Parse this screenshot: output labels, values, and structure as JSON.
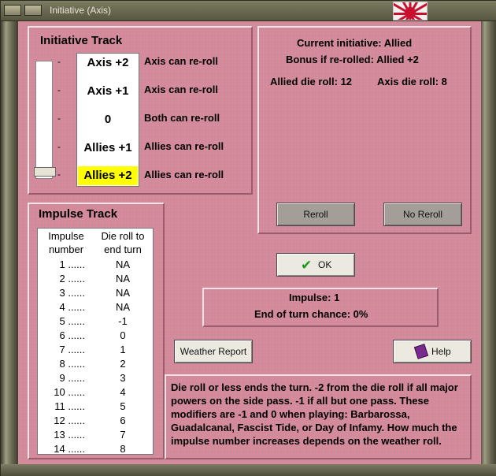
{
  "window": {
    "title": "Initiative (Axis)"
  },
  "initiative_track": {
    "title": "Initiative Track",
    "levels": [
      {
        "label": "Axis +2",
        "desc": "Axis can re-roll",
        "highlight": false
      },
      {
        "label": "Axis +1",
        "desc": "Axis can re-roll",
        "highlight": false
      },
      {
        "label": "0",
        "desc": "Both can re-roll",
        "highlight": false
      },
      {
        "label": "Allies +1",
        "desc": "Allies can re-roll",
        "highlight": false
      },
      {
        "label": "Allies +2",
        "desc": "Allies can re-roll",
        "highlight": true
      }
    ],
    "tick": "-",
    "selected_level": "Allies +2"
  },
  "status": {
    "current_initiative": "Current initiative: Allied",
    "bonus": "Bonus if re-rolled: Allied +2",
    "allied_roll": "Allied die roll: 12",
    "axis_roll": "Axis die roll: 8"
  },
  "buttons": {
    "reroll": "Reroll",
    "no_reroll": "No Reroll",
    "ok": "OK",
    "weather_report": "Weather Report",
    "help": "Help"
  },
  "impulse_info": {
    "impulse": "Impulse: 1",
    "end_chance": "End of turn chance: 0%"
  },
  "impulse_track": {
    "title": "Impulse Track",
    "col1_header": [
      "Impulse",
      "number"
    ],
    "col2_header": [
      "Die roll to",
      "end turn"
    ],
    "rows": [
      {
        "num": "1 ......",
        "val": "NA"
      },
      {
        "num": "2 ......",
        "val": "NA"
      },
      {
        "num": "3 ......",
        "val": "NA"
      },
      {
        "num": "4 ......",
        "val": "NA"
      },
      {
        "num": "5 ......",
        "val": "-1"
      },
      {
        "num": "6 ......",
        "val": "0"
      },
      {
        "num": "7 ......",
        "val": "1"
      },
      {
        "num": "8 ......",
        "val": "2"
      },
      {
        "num": "9 ......",
        "val": "3"
      },
      {
        "num": "10 ......",
        "val": "4"
      },
      {
        "num": "11 ......",
        "val": "5"
      },
      {
        "num": "12 ......",
        "val": "6"
      },
      {
        "num": "13 ......",
        "val": "7"
      },
      {
        "num": "14 ......",
        "val": "8"
      }
    ]
  },
  "note": "Die roll or less ends the turn.  -2 from the die roll if all major powers on the side pass.  -1 if all but one pass.  These modifiers are -1 and 0 when playing: Barbarossa, Guadalcanal, Fascist Tide, or Day of Infamy.  How much the impulse number increases depends on the weather roll.",
  "colors": {
    "background": "#d48c9c",
    "highlight": "#ffff00",
    "ok_check": "#1a9a1a"
  },
  "icons": [
    "checkmark-icon",
    "help-book-icon",
    "japan-flag-icon"
  ]
}
